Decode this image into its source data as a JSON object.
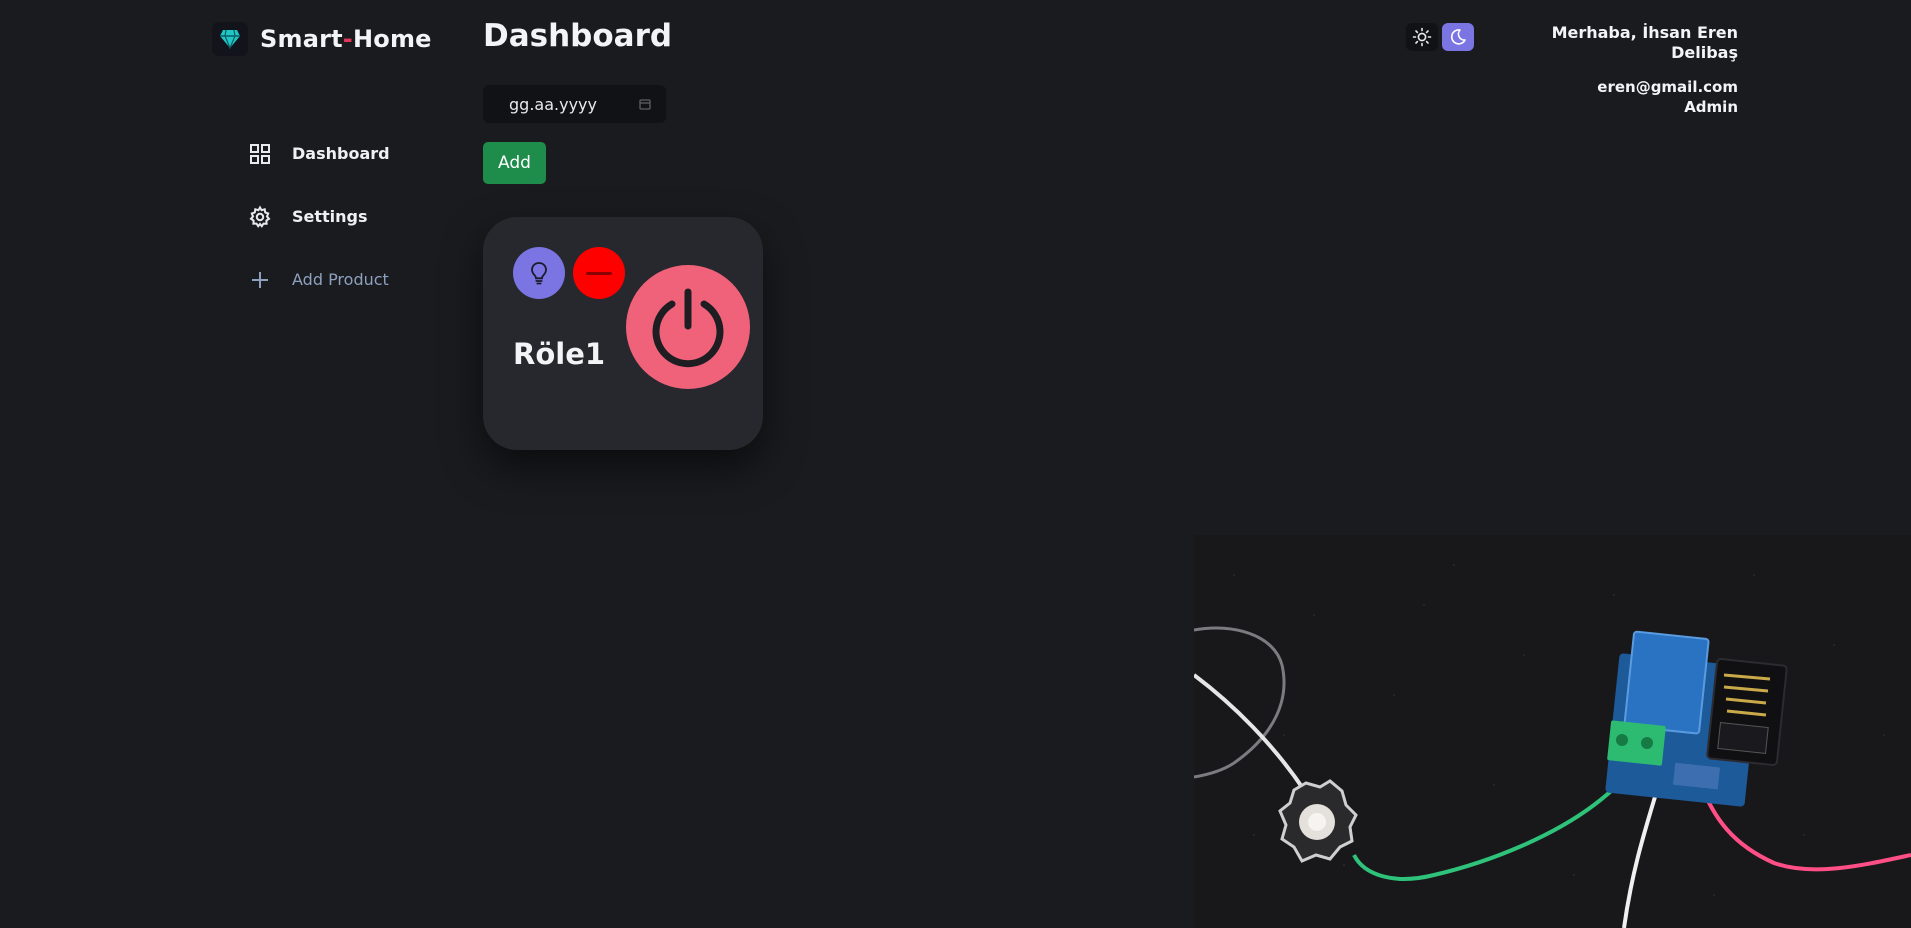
{
  "brand": {
    "title_left": "Smart",
    "title_dash": "-",
    "title_right": "Home",
    "logo_icon": "diamond-icon",
    "accent": "#e2365b"
  },
  "sidebar": {
    "items": [
      {
        "label": "Dashboard",
        "icon": "grid-icon"
      },
      {
        "label": "Settings",
        "icon": "gear-icon"
      },
      {
        "label": "Add Product",
        "icon": "plus-icon"
      }
    ]
  },
  "main": {
    "title": "Dashboard",
    "date_field": {
      "value": "gg.aa.yyyy",
      "icon": "calendar-icon"
    },
    "add_label": "Add",
    "add_color": "#1e8c4a"
  },
  "device": {
    "name": "Röle1",
    "icon": "lightbulb-icon",
    "status_icon": "minus-icon",
    "status_color": "#ff0000",
    "power_icon": "power-icon",
    "power_color": "#f0627a"
  },
  "theme": {
    "light_icon": "sun-icon",
    "dark_icon": "moon-icon",
    "active": "dark",
    "accent": "#7b74e3"
  },
  "user": {
    "greeting": "Merhaba, İhsan Eren Delibaş",
    "email": "eren@gmail.com",
    "role": "Admin"
  }
}
